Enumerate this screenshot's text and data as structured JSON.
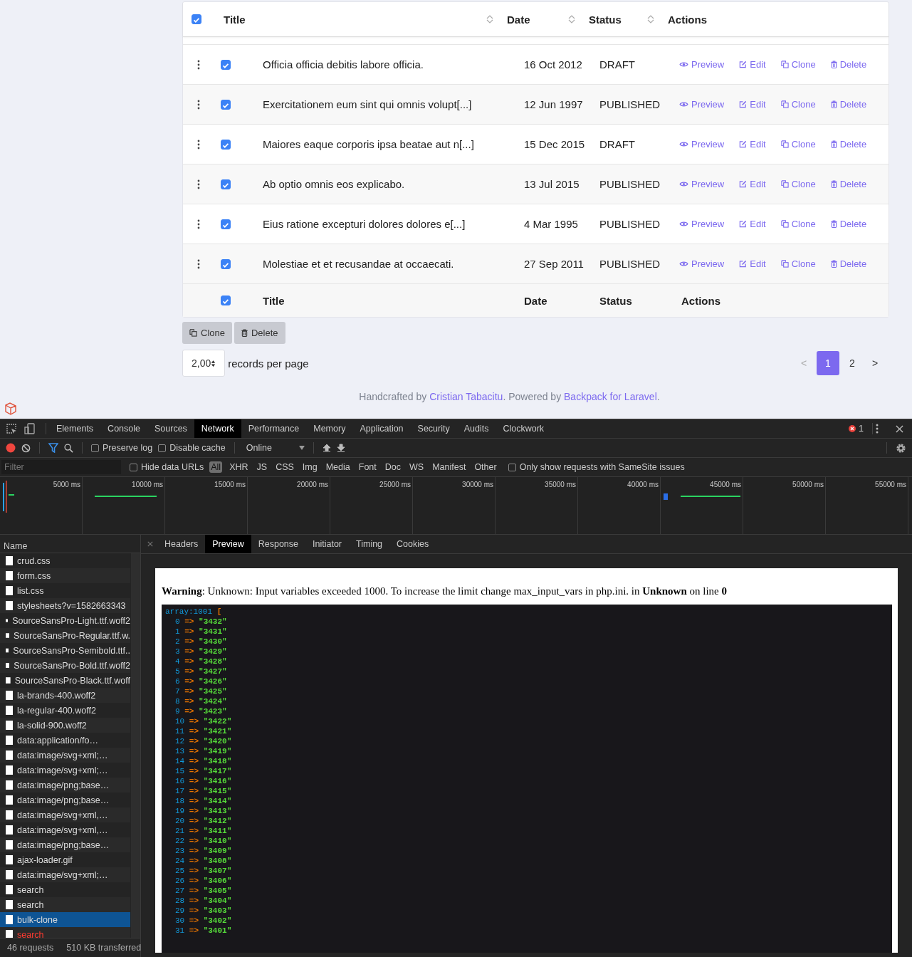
{
  "table": {
    "header": {
      "checked": true,
      "columns": [
        {
          "label": "Title",
          "sortable": true
        },
        {
          "label": "Date",
          "sortable": true
        },
        {
          "label": "Status",
          "sortable": true
        },
        {
          "label": "Actions",
          "sortable": false
        }
      ]
    },
    "rows": [
      {
        "checked": true,
        "title": "Officia officia debitis labore officia.",
        "date": "16 Oct 2012",
        "status": "DRAFT",
        "actions": [
          "Preview",
          "Edit",
          "Clone",
          "Delete"
        ]
      },
      {
        "checked": true,
        "title": "Exercitationem eum sint qui omnis volupt[...]",
        "date": "12 Jun 1997",
        "status": "PUBLISHED",
        "actions": [
          "Preview",
          "Edit",
          "Clone",
          "Delete"
        ]
      },
      {
        "checked": true,
        "title": "Maiores eaque corporis ipsa beatae aut n[...]",
        "date": "15 Dec 2015",
        "status": "DRAFT",
        "actions": [
          "Preview",
          "Edit",
          "Clone",
          "Delete"
        ]
      },
      {
        "checked": true,
        "title": "Ab optio omnis eos explicabo.",
        "date": "13 Jul 2015",
        "status": "PUBLISHED",
        "actions": [
          "Preview",
          "Edit",
          "Clone",
          "Delete"
        ]
      },
      {
        "checked": true,
        "title": "Eius ratione excepturi dolores dolores e[...]",
        "date": "4 Mar 1995",
        "status": "PUBLISHED",
        "actions": [
          "Preview",
          "Edit",
          "Clone",
          "Delete"
        ]
      },
      {
        "checked": true,
        "title": "Molestiae et et recusandae at occaecati.",
        "date": "27 Sep 2011",
        "status": "PUBLISHED",
        "actions": [
          "Preview",
          "Edit",
          "Clone",
          "Delete"
        ]
      }
    ],
    "footer": {
      "checked": true,
      "columns": [
        "Title",
        "Date",
        "Status",
        "Actions"
      ]
    }
  },
  "bulk_buttons": [
    "Clone",
    "Delete"
  ],
  "page_length": {
    "value": "2,00",
    "label": "records per page"
  },
  "pagination": {
    "prev": "<",
    "pages": [
      {
        "label": "1",
        "selected": true
      },
      {
        "label": "2",
        "selected": false
      }
    ],
    "next": ">"
  },
  "credits": [
    {
      "text": "Handcrafted by ",
      "link": false
    },
    {
      "text": "Cristian Tabacitu",
      "link": true
    },
    {
      "text": ". Powered by ",
      "link": false
    },
    {
      "text": "Backpack for Laravel",
      "link": true
    },
    {
      "text": ".",
      "link": false
    }
  ],
  "devtools": {
    "tabs": [
      {
        "label": "Elements",
        "selected": false
      },
      {
        "label": "Console",
        "selected": false
      },
      {
        "label": "Sources",
        "selected": false
      },
      {
        "label": "Network",
        "selected": true
      },
      {
        "label": "Performance",
        "selected": false
      },
      {
        "label": "Memory",
        "selected": false
      },
      {
        "label": "Application",
        "selected": false
      },
      {
        "label": "Security",
        "selected": false
      },
      {
        "label": "Audits",
        "selected": false
      },
      {
        "label": "Clockwork",
        "selected": false
      }
    ],
    "error_count": "1",
    "preserve_log": {
      "label": "Preserve log",
      "checked": false
    },
    "disable_cache": {
      "label": "Disable cache",
      "checked": false
    },
    "throttling": "Online",
    "filter": {
      "placeholder": "Filter"
    },
    "hide_data_urls": {
      "label": "Hide data URLs",
      "checked": false
    },
    "types": [
      {
        "label": "All",
        "selected": true
      },
      {
        "label": "XHR",
        "selected": false
      },
      {
        "label": "JS",
        "selected": false
      },
      {
        "label": "CSS",
        "selected": false
      },
      {
        "label": "Img",
        "selected": false
      },
      {
        "label": "Media",
        "selected": false
      },
      {
        "label": "Font",
        "selected": false
      },
      {
        "label": "Doc",
        "selected": false
      },
      {
        "label": "WS",
        "selected": false
      },
      {
        "label": "Manifest",
        "selected": false
      },
      {
        "label": "Other",
        "selected": false
      }
    ],
    "samesite": {
      "label": "Only show requests with SameSite issues",
      "checked": false
    },
    "timeline_ticks": [
      "5000 ms",
      "10000 ms",
      "15000 ms",
      "20000 ms",
      "25000 ms",
      "30000 ms",
      "35000 ms",
      "40000 ms",
      "45000 ms",
      "50000 ms",
      "55000 ms"
    ],
    "name_header": "Name",
    "requests": [
      {
        "name": "crud.css",
        "selected": false,
        "failed": false
      },
      {
        "name": "form.css",
        "selected": false,
        "failed": false
      },
      {
        "name": "list.css",
        "selected": false,
        "failed": false
      },
      {
        "name": "stylesheets?v=1582663343",
        "selected": false,
        "failed": false
      },
      {
        "name": "SourceSansPro-Light.ttf.woff2",
        "selected": false,
        "failed": false
      },
      {
        "name": "SourceSansPro-Regular.ttf.w.",
        "selected": false,
        "failed": false
      },
      {
        "name": "SourceSansPro-Semibold.ttf..",
        "selected": false,
        "failed": false
      },
      {
        "name": "SourceSansPro-Bold.ttf.woff2",
        "selected": false,
        "failed": false
      },
      {
        "name": "SourceSansPro-Black.ttf.woff",
        "selected": false,
        "failed": false
      },
      {
        "name": "la-brands-400.woff2",
        "selected": false,
        "failed": false
      },
      {
        "name": "la-regular-400.woff2",
        "selected": false,
        "failed": false
      },
      {
        "name": "la-solid-900.woff2",
        "selected": false,
        "failed": false
      },
      {
        "name": "data:application/fo…",
        "selected": false,
        "failed": false
      },
      {
        "name": "data:image/svg+xml;…",
        "selected": false,
        "failed": false
      },
      {
        "name": "data:image/svg+xml;…",
        "selected": false,
        "failed": false
      },
      {
        "name": "data:image/png;base…",
        "selected": false,
        "failed": false
      },
      {
        "name": "data:image/png;base…",
        "selected": false,
        "failed": false
      },
      {
        "name": "data:image/svg+xml,…",
        "selected": false,
        "failed": false
      },
      {
        "name": "data:image/svg+xml,…",
        "selected": false,
        "failed": false
      },
      {
        "name": "data:image/png;base…",
        "selected": false,
        "failed": false
      },
      {
        "name": "ajax-loader.gif",
        "selected": false,
        "failed": false
      },
      {
        "name": "data:image/svg+xml;…",
        "selected": false,
        "failed": false
      },
      {
        "name": "search",
        "selected": false,
        "failed": false
      },
      {
        "name": "search",
        "selected": false,
        "failed": false
      },
      {
        "name": "bulk-clone",
        "selected": true,
        "failed": false
      },
      {
        "name": "search",
        "selected": false,
        "failed": true
      }
    ],
    "detail_tabs": [
      {
        "label": "Headers",
        "selected": false
      },
      {
        "label": "Preview",
        "selected": true
      },
      {
        "label": "Response",
        "selected": false
      },
      {
        "label": "Initiator",
        "selected": false
      },
      {
        "label": "Timing",
        "selected": false
      },
      {
        "label": "Cookies",
        "selected": false
      }
    ],
    "preview": {
      "warning": "**Warning**: Unknown: Input variables exceeded 1000. To increase the limit change max_input_vars in php.ini. in **Unknown** on line **0**",
      "dump_type": "array:1001",
      "dump_open": "[",
      "entries": [
        {
          "key": "0",
          "arrow": "=>",
          "value": "\"3432\""
        },
        {
          "key": "1",
          "arrow": "=>",
          "value": "\"3431\""
        },
        {
          "key": "2",
          "arrow": "=>",
          "value": "\"3430\""
        },
        {
          "key": "3",
          "arrow": "=>",
          "value": "\"3429\""
        },
        {
          "key": "4",
          "arrow": "=>",
          "value": "\"3428\""
        },
        {
          "key": "5",
          "arrow": "=>",
          "value": "\"3427\""
        },
        {
          "key": "6",
          "arrow": "=>",
          "value": "\"3426\""
        },
        {
          "key": "7",
          "arrow": "=>",
          "value": "\"3425\""
        },
        {
          "key": "8",
          "arrow": "=>",
          "value": "\"3424\""
        },
        {
          "key": "9",
          "arrow": "=>",
          "value": "\"3423\""
        },
        {
          "key": "10",
          "arrow": "=>",
          "value": "\"3422\""
        },
        {
          "key": "11",
          "arrow": "=>",
          "value": "\"3421\""
        },
        {
          "key": "12",
          "arrow": "=>",
          "value": "\"3420\""
        },
        {
          "key": "13",
          "arrow": "=>",
          "value": "\"3419\""
        },
        {
          "key": "14",
          "arrow": "=>",
          "value": "\"3418\""
        },
        {
          "key": "15",
          "arrow": "=>",
          "value": "\"3417\""
        },
        {
          "key": "16",
          "arrow": "=>",
          "value": "\"3416\""
        },
        {
          "key": "17",
          "arrow": "=>",
          "value": "\"3415\""
        },
        {
          "key": "18",
          "arrow": "=>",
          "value": "\"3414\""
        },
        {
          "key": "19",
          "arrow": "=>",
          "value": "\"3413\""
        },
        {
          "key": "20",
          "arrow": "=>",
          "value": "\"3412\""
        },
        {
          "key": "21",
          "arrow": "=>",
          "value": "\"3411\""
        },
        {
          "key": "22",
          "arrow": "=>",
          "value": "\"3410\""
        },
        {
          "key": "23",
          "arrow": "=>",
          "value": "\"3409\""
        },
        {
          "key": "24",
          "arrow": "=>",
          "value": "\"3408\""
        },
        {
          "key": "25",
          "arrow": "=>",
          "value": "\"3407\""
        },
        {
          "key": "26",
          "arrow": "=>",
          "value": "\"3406\""
        },
        {
          "key": "27",
          "arrow": "=>",
          "value": "\"3405\""
        },
        {
          "key": "28",
          "arrow": "=>",
          "value": "\"3404\""
        },
        {
          "key": "29",
          "arrow": "=>",
          "value": "\"3403\""
        },
        {
          "key": "30",
          "arrow": "=>",
          "value": "\"3402\""
        },
        {
          "key": "31",
          "arrow": "=>",
          "value": "\"3401\""
        }
      ]
    },
    "status": {
      "requests": "46 requests",
      "transferred": "510 KB transferred"
    }
  }
}
